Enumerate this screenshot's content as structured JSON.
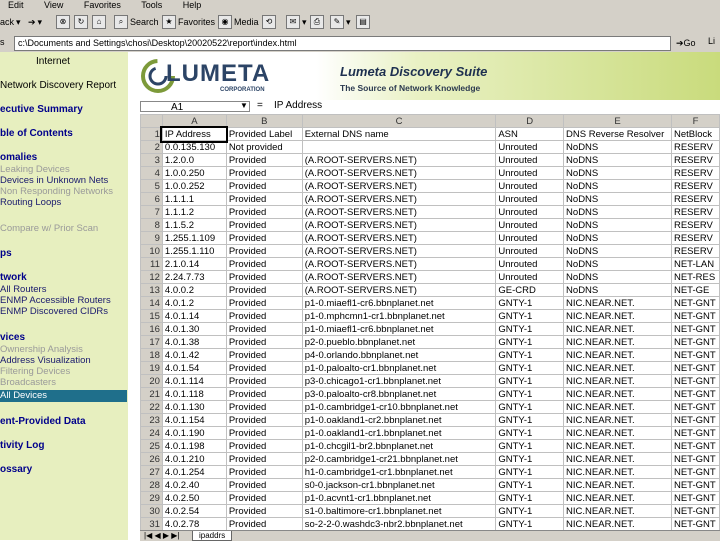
{
  "menu": [
    "Edit",
    "View",
    "Favorites",
    "Tools",
    "Help"
  ],
  "toolbar": {
    "back": "ack",
    "search": "Search",
    "favorites": "Favorites",
    "media": "Media"
  },
  "address": {
    "label": "s",
    "url": "c:\\Documents and Settings\\chosi\\Desktop\\20020522\\report\\index.html",
    "go": "Go",
    "links": "Li"
  },
  "nav": {
    "title_line1": "Internet",
    "title_line2": "Network Discovery Report",
    "sections": [
      {
        "label": "ecutive Summary"
      },
      {
        "label": "ble of Contents"
      },
      {
        "label": "omalies"
      },
      {
        "label": "ps"
      },
      {
        "label": "twork"
      },
      {
        "label": "vices"
      },
      {
        "label": "ent-Provided Data"
      },
      {
        "label": "tivity Log"
      },
      {
        "label": "ossary"
      }
    ],
    "anomalies": [
      "Leaking Devices",
      "Devices in Unknown Nets",
      "Non Responding Networks",
      "Routing Loops"
    ],
    "compare": "Compare w/ Prior Scan",
    "network": [
      "All Routers",
      "ENMP Accessible Routers",
      "ENMP Discovered CIDRs"
    ],
    "devices": [
      "Ownership Analysis",
      "Address Visualization",
      "Filtering Devices",
      "Broadcasters",
      "All Devices"
    ]
  },
  "banner": {
    "logo": "LUMETA",
    "logo_sub": "CORPORATION",
    "suite_title": "Lumeta Discovery Suite",
    "tagline": "The Source of Network Knowledge"
  },
  "formula": {
    "namebox": "A1",
    "eq": "=",
    "value": "IP Address"
  },
  "sheet": {
    "col_letters": [
      "",
      "A",
      "B",
      "C",
      "D",
      "E",
      "F"
    ],
    "row_numbers": [
      "1",
      "2",
      "3",
      "4",
      "5",
      "6",
      "7",
      "8",
      "9",
      "10",
      "11",
      "12",
      "13",
      "14",
      "15",
      "16",
      "17",
      "18",
      "19",
      "20",
      "21",
      "22",
      "23",
      "24",
      "25",
      "26",
      "27",
      "28",
      "29",
      "30",
      "31"
    ],
    "headers": [
      "IP Address",
      "Provided Label",
      "External DNS name",
      "ASN",
      "DNS Reverse Resolver",
      "NetBlock"
    ],
    "rows": [
      [
        "0.0.135.130",
        "Not provided",
        "",
        "Unrouted",
        "NoDNS",
        "RESERV"
      ],
      [
        "1.2.0.0",
        "Provided",
        "(A.ROOT-SERVERS.NET)",
        "Unrouted",
        "NoDNS",
        "RESERV"
      ],
      [
        "1.0.0.250",
        "Provided",
        "(A.ROOT-SERVERS.NET)",
        "Unrouted",
        "NoDNS",
        "RESERV"
      ],
      [
        "1.0.0.252",
        "Provided",
        "(A.ROOT-SERVERS.NET)",
        "Unrouted",
        "NoDNS",
        "RESERV"
      ],
      [
        "1.1.1.1",
        "Provided",
        "(A.ROOT-SERVERS.NET)",
        "Unrouted",
        "NoDNS",
        "RESERV"
      ],
      [
        "1.1.1.2",
        "Provided",
        "(A.ROOT-SERVERS.NET)",
        "Unrouted",
        "NoDNS",
        "RESERV"
      ],
      [
        "1.1.5.2",
        "Provided",
        "(A.ROOT-SERVERS.NET)",
        "Unrouted",
        "NoDNS",
        "RESERV"
      ],
      [
        "1.255.1.109",
        "Provided",
        "(A.ROOT-SERVERS.NET)",
        "Unrouted",
        "NoDNS",
        "RESERV"
      ],
      [
        "1.255.1.110",
        "Provided",
        "(A.ROOT-SERVERS.NET)",
        "Unrouted",
        "NoDNS",
        "RESERV"
      ],
      [
        "2.1.0.14",
        "Provided",
        "(A.ROOT-SERVERS.NET)",
        "Unrouted",
        "NoDNS",
        "NET-LAN"
      ],
      [
        "2.24.7.73",
        "Provided",
        "(A.ROOT-SERVERS.NET)",
        "Unrouted",
        "NoDNS",
        "NET-RES"
      ],
      [
        "4.0.0.2",
        "Provided",
        "(A.ROOT-SERVERS.NET)",
        "GE-CRD",
        "NoDNS",
        "NET-GE"
      ],
      [
        "4.0.1.2",
        "Provided",
        "p1-0.miaefl1-cr6.bbnplanet.net",
        "GNTY-1",
        "NIC.NEAR.NET.",
        "NET-GNT"
      ],
      [
        "4.0.1.14",
        "Provided",
        "p1-0.mphcmn1-cr1.bbnplanet.net",
        "GNTY-1",
        "NIC.NEAR.NET.",
        "NET-GNT"
      ],
      [
        "4.0.1.30",
        "Provided",
        "p1-0.miaefl1-cr6.bbnplanet.net",
        "GNTY-1",
        "NIC.NEAR.NET.",
        "NET-GNT"
      ],
      [
        "4.0.1.38",
        "Provided",
        "p2-0.pueblo.bbnplanet.net",
        "GNTY-1",
        "NIC.NEAR.NET.",
        "NET-GNT"
      ],
      [
        "4.0.1.42",
        "Provided",
        "p4-0.orlando.bbnplanet.net",
        "GNTY-1",
        "NIC.NEAR.NET.",
        "NET-GNT"
      ],
      [
        "4.0.1.54",
        "Provided",
        "p1-0.paloalto-cr1.bbnplanet.net",
        "GNTY-1",
        "NIC.NEAR.NET.",
        "NET-GNT"
      ],
      [
        "4.0.1.114",
        "Provided",
        "p3-0.chicago1-cr1.bbnplanet.net",
        "GNTY-1",
        "NIC.NEAR.NET.",
        "NET-GNT"
      ],
      [
        "4.0.1.118",
        "Provided",
        "p3-0.paloalto-cr8.bbnplanet.net",
        "GNTY-1",
        "NIC.NEAR.NET.",
        "NET-GNT"
      ],
      [
        "4.0.1.130",
        "Provided",
        "p1-0.cambridge1-cr10.bbnplanet.net",
        "GNTY-1",
        "NIC.NEAR.NET.",
        "NET-GNT"
      ],
      [
        "4.0.1.154",
        "Provided",
        "p1-0.oakland1-cr2.bbnplanet.net",
        "GNTY-1",
        "NIC.NEAR.NET.",
        "NET-GNT"
      ],
      [
        "4.0.1.190",
        "Provided",
        "p1-0.oakland1-cr1.bbnplanet.net",
        "GNTY-1",
        "NIC.NEAR.NET.",
        "NET-GNT"
      ],
      [
        "4.0.1.198",
        "Provided",
        "p1-0.chcgil1-br2.bbnplanet.net",
        "GNTY-1",
        "NIC.NEAR.NET.",
        "NET-GNT"
      ],
      [
        "4.0.1.210",
        "Provided",
        "p2-0.cambridge1-cr21.bbnplanet.net",
        "GNTY-1",
        "NIC.NEAR.NET.",
        "NET-GNT"
      ],
      [
        "4.0.1.254",
        "Provided",
        "h1-0.cambridge1-cr1.bbnplanet.net",
        "GNTY-1",
        "NIC.NEAR.NET.",
        "NET-GNT"
      ],
      [
        "4.0.2.40",
        "Provided",
        "s0-0.jackson-cr1.bbnplanet.net",
        "GNTY-1",
        "NIC.NEAR.NET.",
        "NET-GNT"
      ],
      [
        "4.0.2.50",
        "Provided",
        "p1-0.acvnt1-cr1.bbnplanet.net",
        "GNTY-1",
        "NIC.NEAR.NET.",
        "NET-GNT"
      ],
      [
        "4.0.2.54",
        "Provided",
        "s1-0.baltimore-cr1.bbnplanet.net",
        "GNTY-1",
        "NIC.NEAR.NET.",
        "NET-GNT"
      ],
      [
        "4.0.2.78",
        "Provided",
        "so-2-2-0.washdc3-nbr2.bbnplanet.net",
        "GNTY-1",
        "NIC.NEAR.NET.",
        "NET-GNT"
      ]
    ],
    "tab": "ipaddrs"
  }
}
